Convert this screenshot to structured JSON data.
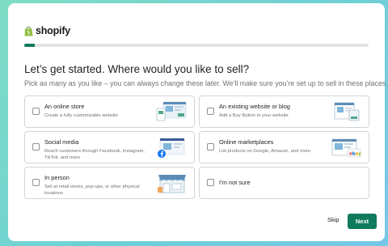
{
  "brand": {
    "name": "shopify",
    "accent": "#0f7a5c"
  },
  "progress": {
    "fraction": 0.03
  },
  "heading": "Let’s get started. Where would you like to sell?",
  "subheading": "Pick as many as you like – you can always change these later. We’ll make sure you’re set up to sell in these places.",
  "options": [
    {
      "title": "An online store",
      "description": "Create a fully customizable website",
      "icon": "online-store-illustration",
      "checked": false
    },
    {
      "title": "An existing website or blog",
      "description": "Add a Buy Button to your website",
      "icon": "existing-website-illustration",
      "checked": false
    },
    {
      "title": "Social media",
      "description": "Reach customers through Facebook, Instagram, TikTok, and more",
      "icon": "social-media-illustration",
      "checked": false
    },
    {
      "title": "Online marketplaces",
      "description": "List products on Google, Amazon, and more",
      "icon": "marketplaces-illustration",
      "checked": false
    },
    {
      "title": "In person",
      "description": "Sell at retail stores, pop-ups, or other physical locations",
      "icon": "storefront-illustration",
      "checked": false
    },
    {
      "title": "I’m not sure",
      "description": "",
      "icon": "",
      "checked": false
    }
  ],
  "actions": {
    "skip": "Skip",
    "next": "Next"
  }
}
